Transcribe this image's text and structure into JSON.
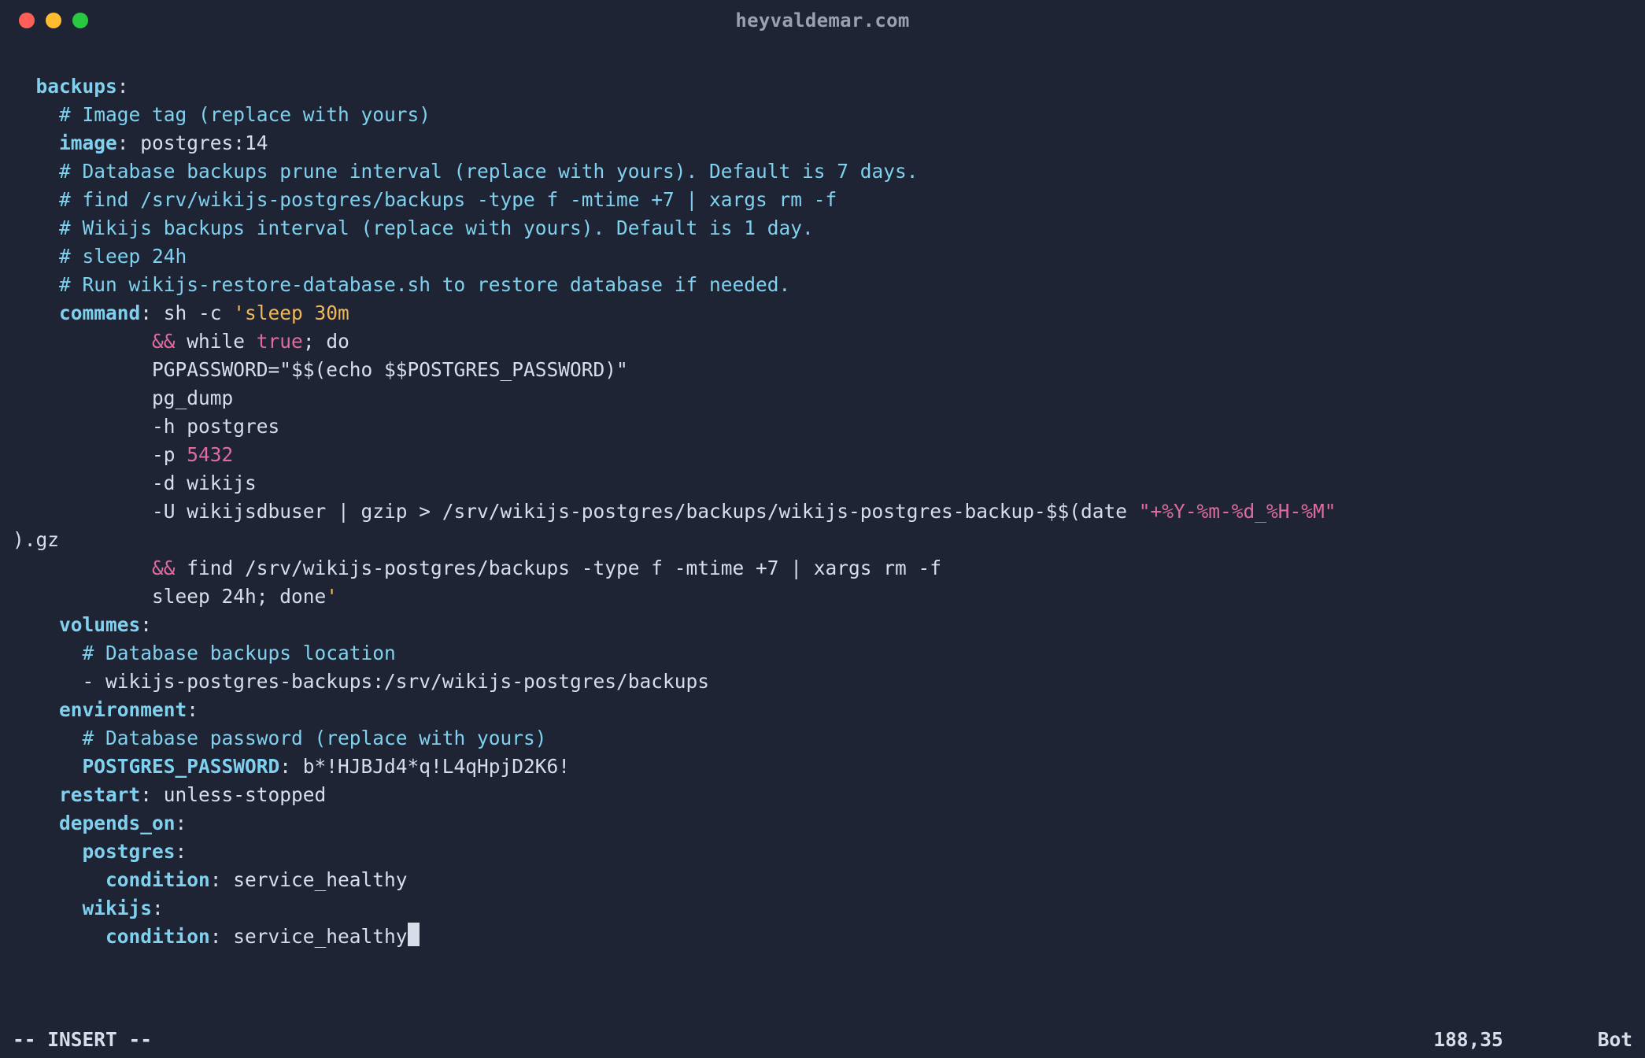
{
  "titlebar": {
    "title": "heyvaldemar.com"
  },
  "code": {
    "lines": [
      {
        "indent": "  ",
        "segments": [
          {
            "cls": "kw",
            "t": "backups"
          },
          {
            "cls": "plain",
            "t": ":"
          }
        ]
      },
      {
        "indent": "    ",
        "segments": [
          {
            "cls": "cmt",
            "t": "# Image tag (replace with yours)"
          }
        ]
      },
      {
        "indent": "    ",
        "segments": [
          {
            "cls": "kw",
            "t": "image"
          },
          {
            "cls": "plain",
            "t": ": postgres:14"
          }
        ]
      },
      {
        "indent": "    ",
        "segments": [
          {
            "cls": "cmt",
            "t": "# Database backups prune interval (replace with yours). Default is 7 days."
          }
        ]
      },
      {
        "indent": "    ",
        "segments": [
          {
            "cls": "cmt",
            "t": "# find /srv/wikijs-postgres/backups -type f -mtime +7 | xargs rm -f"
          }
        ]
      },
      {
        "indent": "",
        "segments": [
          {
            "cls": "plain",
            "t": ""
          }
        ]
      },
      {
        "indent": "    ",
        "segments": [
          {
            "cls": "cmt",
            "t": "# Wikijs backups interval (replace with yours). Default is 1 day."
          }
        ]
      },
      {
        "indent": "    ",
        "segments": [
          {
            "cls": "cmt",
            "t": "# sleep 24h"
          }
        ]
      },
      {
        "indent": "",
        "segments": [
          {
            "cls": "plain",
            "t": ""
          }
        ]
      },
      {
        "indent": "    ",
        "segments": [
          {
            "cls": "cmt",
            "t": "# Run wikijs-restore-database.sh to restore database if needed."
          }
        ]
      },
      {
        "indent": "    ",
        "segments": [
          {
            "cls": "kw",
            "t": "command"
          },
          {
            "cls": "plain",
            "t": ": sh -c "
          },
          {
            "cls": "str",
            "t": "'sleep 30m"
          }
        ]
      },
      {
        "indent": "            ",
        "segments": [
          {
            "cls": "op-and",
            "t": "&&"
          },
          {
            "cls": "plain",
            "t": " while "
          },
          {
            "cls": "op-true",
            "t": "true"
          },
          {
            "cls": "plain",
            "t": "; do"
          }
        ]
      },
      {
        "indent": "            ",
        "segments": [
          {
            "cls": "plain",
            "t": "PGPASSWORD=\"$$(echo $$POSTGRES_PASSWORD)\""
          }
        ]
      },
      {
        "indent": "            ",
        "segments": [
          {
            "cls": "plain",
            "t": "pg_dump"
          }
        ]
      },
      {
        "indent": "            ",
        "segments": [
          {
            "cls": "plain",
            "t": "-h postgres"
          }
        ]
      },
      {
        "indent": "            ",
        "segments": [
          {
            "cls": "plain",
            "t": "-p "
          },
          {
            "cls": "num",
            "t": "5432"
          }
        ]
      },
      {
        "indent": "            ",
        "segments": [
          {
            "cls": "plain",
            "t": "-d wikijs"
          }
        ]
      },
      {
        "indent": "            ",
        "segments": [
          {
            "cls": "plain",
            "t": "-U wikijsdbuser | gzip > /srv/wikijs-postgres/backups/wikijs-postgres-backup-$$(date "
          },
          {
            "cls": "fmt",
            "t": "\"+%Y-%m-%d_%H-%M\""
          }
        ]
      },
      {
        "indent": "",
        "segments": [
          {
            "cls": "plain",
            "t": ").gz"
          }
        ]
      },
      {
        "indent": "            ",
        "segments": [
          {
            "cls": "op-and",
            "t": "&&"
          },
          {
            "cls": "plain",
            "t": " find /srv/wikijs-postgres/backups -type f -mtime +7 | xargs rm -f"
          }
        ]
      },
      {
        "indent": "            ",
        "segments": [
          {
            "cls": "plain",
            "t": "sleep 24h; done"
          },
          {
            "cls": "str",
            "t": "'"
          }
        ]
      },
      {
        "indent": "    ",
        "segments": [
          {
            "cls": "kw",
            "t": "volumes"
          },
          {
            "cls": "plain",
            "t": ":"
          }
        ]
      },
      {
        "indent": "      ",
        "segments": [
          {
            "cls": "cmt",
            "t": "# Database backups location"
          }
        ]
      },
      {
        "indent": "      ",
        "segments": [
          {
            "cls": "plain",
            "t": "- wikijs-postgres-backups:/srv/wikijs-postgres/backups"
          }
        ]
      },
      {
        "indent": "    ",
        "segments": [
          {
            "cls": "kw",
            "t": "environment"
          },
          {
            "cls": "plain",
            "t": ":"
          }
        ]
      },
      {
        "indent": "      ",
        "segments": [
          {
            "cls": "cmt",
            "t": "# Database password (replace with yours)"
          }
        ]
      },
      {
        "indent": "      ",
        "segments": [
          {
            "cls": "kw",
            "t": "POSTGRES_PASSWORD"
          },
          {
            "cls": "plain",
            "t": ": b*!HJBJd4*q!L4qHpjD2K6!"
          }
        ]
      },
      {
        "indent": "    ",
        "segments": [
          {
            "cls": "kw",
            "t": "restart"
          },
          {
            "cls": "plain",
            "t": ": unless-stopped"
          }
        ]
      },
      {
        "indent": "    ",
        "segments": [
          {
            "cls": "kw",
            "t": "depends_on"
          },
          {
            "cls": "plain",
            "t": ":"
          }
        ]
      },
      {
        "indent": "      ",
        "segments": [
          {
            "cls": "kw",
            "t": "postgres"
          },
          {
            "cls": "plain",
            "t": ":"
          }
        ]
      },
      {
        "indent": "        ",
        "segments": [
          {
            "cls": "kw",
            "t": "condition"
          },
          {
            "cls": "plain",
            "t": ": service_healthy"
          }
        ]
      },
      {
        "indent": "      ",
        "segments": [
          {
            "cls": "kw",
            "t": "wikijs"
          },
          {
            "cls": "plain",
            "t": ":"
          }
        ]
      },
      {
        "indent": "        ",
        "segments": [
          {
            "cls": "kw",
            "t": "condition"
          },
          {
            "cls": "plain",
            "t": ": service_healthy"
          }
        ],
        "cursor": true
      }
    ]
  },
  "status": {
    "mode": "-- INSERT --",
    "position": "188,35",
    "scroll": "Bot"
  }
}
